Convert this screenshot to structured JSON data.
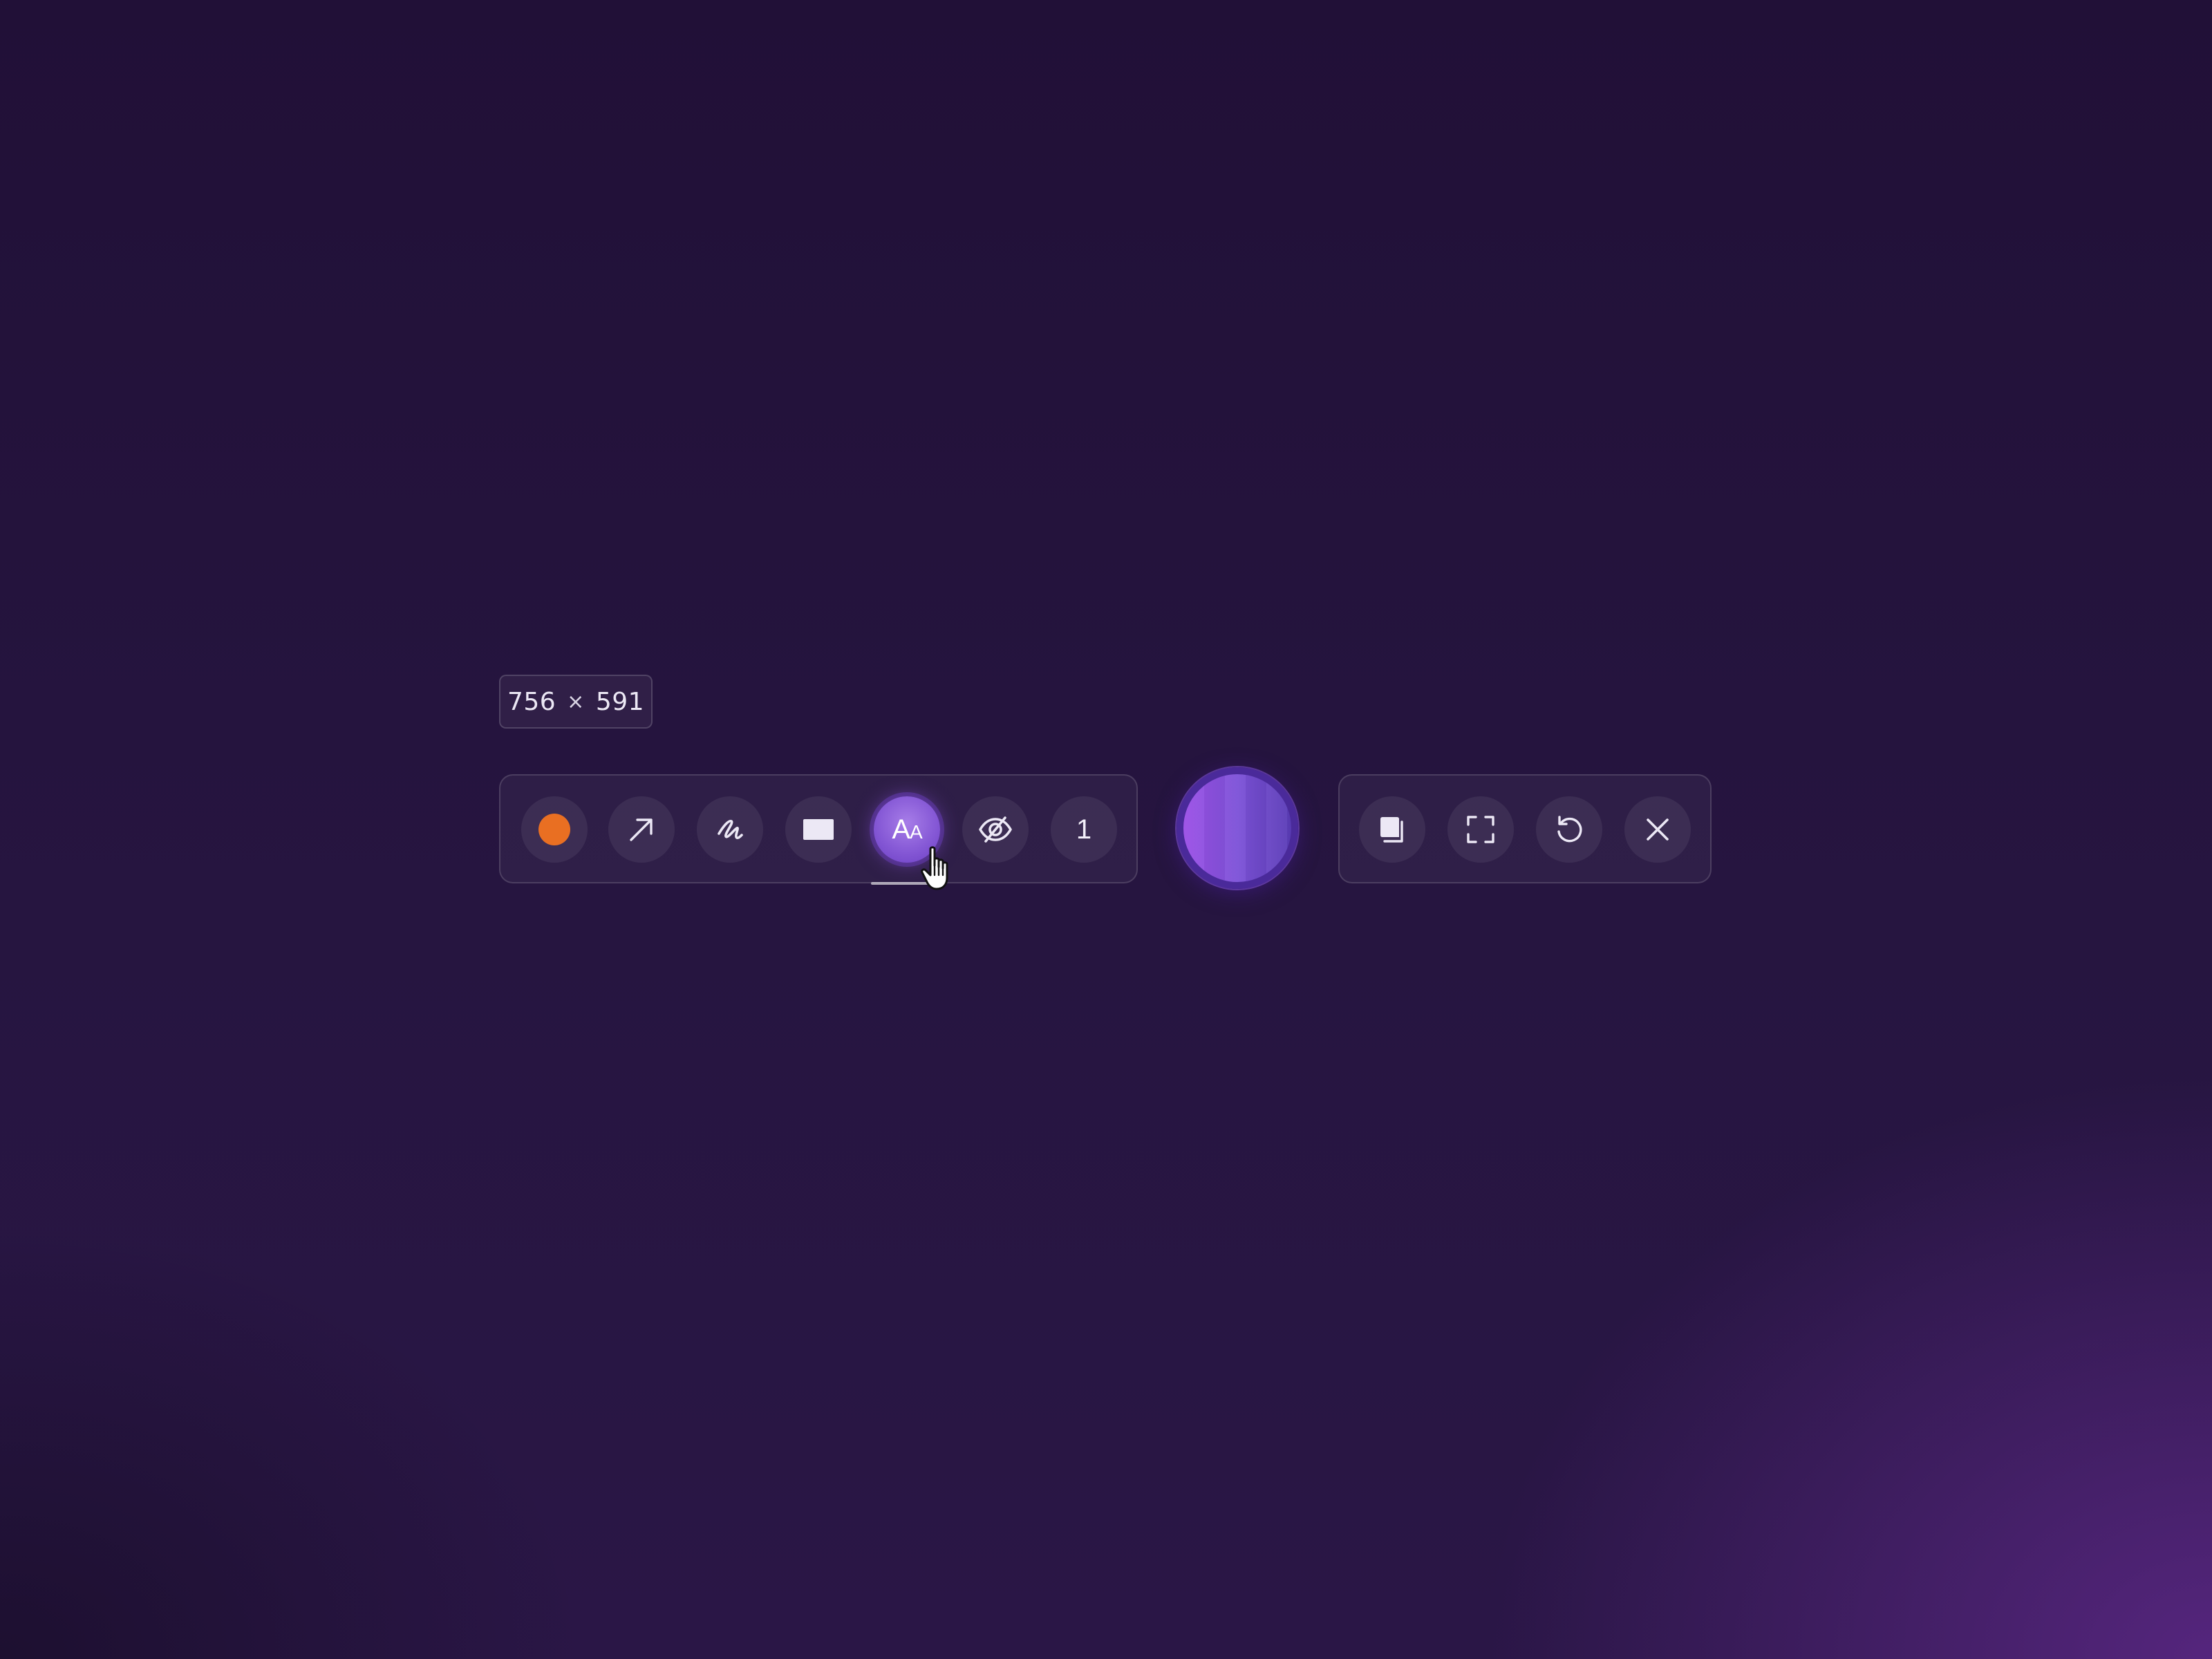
{
  "selection": {
    "width": "756",
    "separator": "×",
    "height": "591"
  },
  "annotation_toolbar": {
    "tools": [
      {
        "name": "color",
        "icon": "color-swatch",
        "color": "#e96f22"
      },
      {
        "name": "arrow",
        "icon": "arrow-icon"
      },
      {
        "name": "pen",
        "icon": "pen-scribble-icon"
      },
      {
        "name": "rectangle",
        "icon": "rectangle-icon"
      },
      {
        "name": "text",
        "icon": "text-aa-icon",
        "label_big": "A",
        "label_small": "A",
        "active": true
      },
      {
        "name": "blur",
        "icon": "eye-off-icon"
      },
      {
        "name": "step",
        "icon": "step-number",
        "label": "1"
      }
    ]
  },
  "capture_button": {
    "icon": "record-button",
    "colors": [
      "#9b4fe6",
      "#5a3cb6"
    ]
  },
  "action_toolbar": {
    "actions": [
      {
        "name": "copy",
        "icon": "copy-icon"
      },
      {
        "name": "fullscreen",
        "icon": "fullscreen-icon"
      },
      {
        "name": "reset",
        "icon": "undo-icon"
      },
      {
        "name": "close",
        "icon": "close-icon"
      }
    ]
  },
  "colors": {
    "accent": "#8659d6",
    "annotation_color": "#e96f22"
  }
}
